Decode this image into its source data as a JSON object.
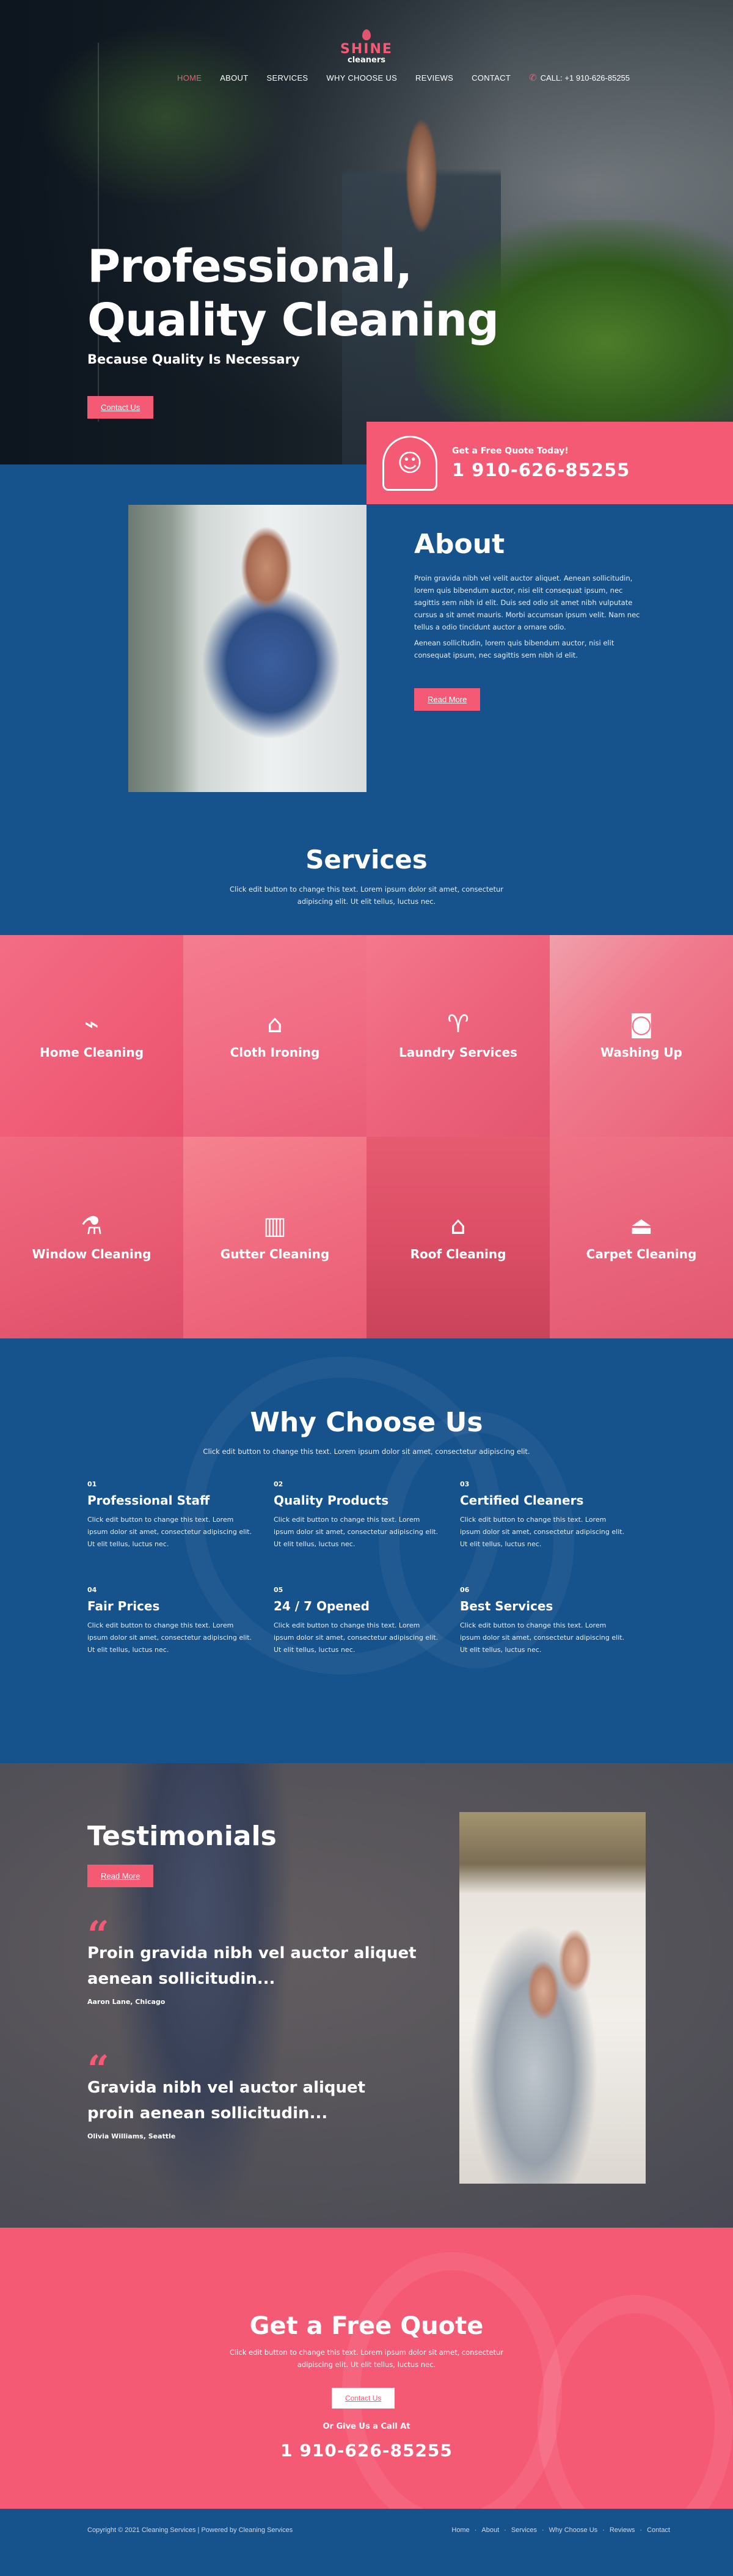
{
  "brand": {
    "name": "SHINE",
    "sub": "cleaners",
    "accent": "#f55a74",
    "primary": "#16528c"
  },
  "nav": {
    "items": [
      "HOME",
      "ABOUT",
      "SERVICES",
      "WHY CHOOSE US",
      "REVIEWS",
      "CONTACT"
    ],
    "phone": "CALL: +1 910-626-85255"
  },
  "hero": {
    "title_line1": "Professional,",
    "title_line2": "Quality Cleaning",
    "subtitle": "Because Quality Is Necessary",
    "button": "Contact Us"
  },
  "quote_box": {
    "label": "Get a Free Quote Today!",
    "phone": "1 910-626-85255"
  },
  "about": {
    "title": "About",
    "p1": "Proin gravida nibh vel velit auctor aliquet. Aenean sollicitudin, lorem quis bibendum auctor, nisi elit consequat ipsum, nec sagittis sem nibh id elit. Duis sed odio sit amet nibh vulputate cursus a sit amet mauris. Morbi accumsan ipsum velit. Nam nec tellus a odio tincidunt auctor a ornare odio.",
    "p2": "Aenean sollicitudin, lorem quis bibendum auctor, nisi elit consequat ipsum, nec sagittis sem nibh id elit.",
    "button": "Read More"
  },
  "services": {
    "title": "Services",
    "desc": "Click edit button to change this text. Lorem ipsum dolor sit amet, consectetur adipiscing elit. Ut elit tellus, luctus nec.",
    "items": [
      {
        "label": "Home Cleaning",
        "icon": "broom-icon"
      },
      {
        "label": "Cloth Ironing",
        "icon": "iron-icon"
      },
      {
        "label": "Laundry Services",
        "icon": "shirt-icon"
      },
      {
        "label": "Washing Up",
        "icon": "washing-machine-icon"
      },
      {
        "label": "Window Cleaning",
        "icon": "spray-bottle-icon"
      },
      {
        "label": "Gutter Cleaning",
        "icon": "gutter-icon"
      },
      {
        "label": "Roof Cleaning",
        "icon": "house-icon"
      },
      {
        "label": "Carpet Cleaning",
        "icon": "vacuum-icon"
      }
    ]
  },
  "why": {
    "title": "Why Choose Us",
    "desc": "Click edit button to change this text. Lorem ipsum dolor sit amet, consectetur adipiscing elit.",
    "items": [
      {
        "num": "01",
        "title": "Professional Staff",
        "desc": "Click edit button to change this text. Lorem ipsum dolor sit amet, consectetur adipiscing elit. Ut elit tellus, luctus nec."
      },
      {
        "num": "02",
        "title": "Quality Products",
        "desc": "Click edit button to change this text. Lorem ipsum dolor sit amet, consectetur adipiscing elit. Ut elit tellus, luctus nec."
      },
      {
        "num": "03",
        "title": "Certified Cleaners",
        "desc": "Click edit button to change this text. Lorem ipsum dolor sit amet, consectetur adipiscing elit. Ut elit tellus, luctus nec."
      },
      {
        "num": "04",
        "title": "Fair Prices",
        "desc": "Click edit button to change this text. Lorem ipsum dolor sit amet, consectetur adipiscing elit. Ut elit tellus, luctus nec."
      },
      {
        "num": "05",
        "title": "24 / 7 Opened",
        "desc": "Click edit button to change this text. Lorem ipsum dolor sit amet, consectetur adipiscing elit. Ut elit tellus, luctus nec."
      },
      {
        "num": "06",
        "title": "Best Services",
        "desc": "Click edit button to change this text. Lorem ipsum dolor sit amet, consectetur adipiscing elit. Ut elit tellus, luctus nec."
      }
    ]
  },
  "testimonials": {
    "title": "Testimonials",
    "button": "Read More",
    "items": [
      {
        "text": "Proin gravida nibh vel auctor aliquet aenean sollicitudin...",
        "author": "Aaron Lane, Chicago"
      },
      {
        "text": "Gravida nibh vel auctor aliquet proin aenean sollicitudin...",
        "author": "Olivia Williams, Seattle"
      }
    ]
  },
  "get_quote": {
    "title": "Get a Free Quote",
    "desc": "Click edit button to change this text. Lorem ipsum dolor sit amet, consectetur adipiscing elit. Ut elit tellus, luctus nec.",
    "button": "Contact Us",
    "call_label": "Or Give Us a Call At",
    "phone": "1 910-626-85255"
  },
  "footer": {
    "copyright": "Copyright © 2021 Cleaning Services | Powered by Cleaning Services",
    "links": [
      "Home",
      "About",
      "Services",
      "Why Choose Us",
      "Reviews",
      "Contact"
    ]
  }
}
